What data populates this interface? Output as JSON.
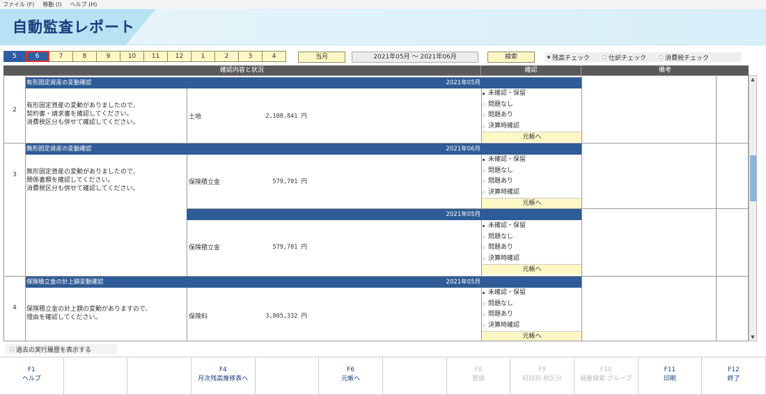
{
  "menu": [
    "ファイル (F)",
    "移動 (I)",
    "ヘルプ (H)"
  ],
  "title": "自動監査レポート",
  "months": [
    "5",
    "6",
    "7",
    "8",
    "9",
    "10",
    "11",
    "12",
    "1",
    "2",
    "3",
    "4"
  ],
  "selected_month": "6",
  "current_month_label": "当月",
  "range": "2021年05月 ～ 2021年06月",
  "search_label": "検索",
  "radios": [
    {
      "label": "残高チェック",
      "checked": true
    },
    {
      "label": "仕訳チェック",
      "checked": false
    },
    {
      "label": "消費税チェック",
      "checked": false
    }
  ],
  "table_headers": {
    "content": "確認内容と状況",
    "confirm": "確認",
    "remarks": "備考"
  },
  "check_options": [
    "未確認・保留",
    "問題なし",
    "問題あり",
    "決算時確認"
  ],
  "ledger_label": "元帳へ",
  "rows": [
    {
      "num": "2",
      "title": "有形固定資産の変動確認",
      "desc": [
        "有形固定資産の変動がありましたので、",
        "契約書・請求書を確認してください。",
        "消費税区分も併せて確認してください。"
      ],
      "entries": [
        {
          "date": "2021年05月",
          "account": "土地",
          "amount": "2,108,841 円"
        }
      ]
    },
    {
      "num": "3",
      "title": "無形固定資産の変動確認",
      "desc": [
        "無形固定資産の変動がありましたので、",
        "関係書類を確認してください。",
        "消費税区分も併せて確認してください。"
      ],
      "entries": [
        {
          "date": "2021年06月",
          "account": "保険積立金",
          "amount": "579,701 円"
        },
        {
          "date": "2021年05月",
          "account": "保険積立金",
          "amount": "579,701 円"
        }
      ]
    },
    {
      "num": "4",
      "title": "保険積立金の計上額変動確認",
      "desc": [
        "保険積立金の計上額の変動がありますので、",
        "理由を確認してください。"
      ],
      "entries": [
        {
          "date": "2021年05月",
          "account": "保険料",
          "amount": "3,805,332 円"
        }
      ]
    }
  ],
  "history_label": "過去の実行履歴を表示する",
  "fkeys": [
    {
      "key": "F1",
      "label": "ヘルプ",
      "enabled": true
    },
    {
      "key": "",
      "label": "",
      "enabled": true
    },
    {
      "key": "",
      "label": "",
      "enabled": true
    },
    {
      "key": "F4",
      "label": "月次残高推移表へ",
      "enabled": true
    },
    {
      "key": "",
      "label": "",
      "enabled": true
    },
    {
      "key": "F6",
      "label": "元帳へ",
      "enabled": true
    },
    {
      "key": "",
      "label": "",
      "enabled": true
    },
    {
      "key": "F8",
      "label": "登録",
      "enabled": false
    },
    {
      "key": "F9",
      "label": "科目別 税区分",
      "enabled": false
    },
    {
      "key": "F10",
      "label": "摘要検索 グループ",
      "enabled": false
    },
    {
      "key": "F11",
      "label": "印刷",
      "enabled": true
    },
    {
      "key": "F12",
      "label": "終了",
      "enabled": true
    }
  ]
}
